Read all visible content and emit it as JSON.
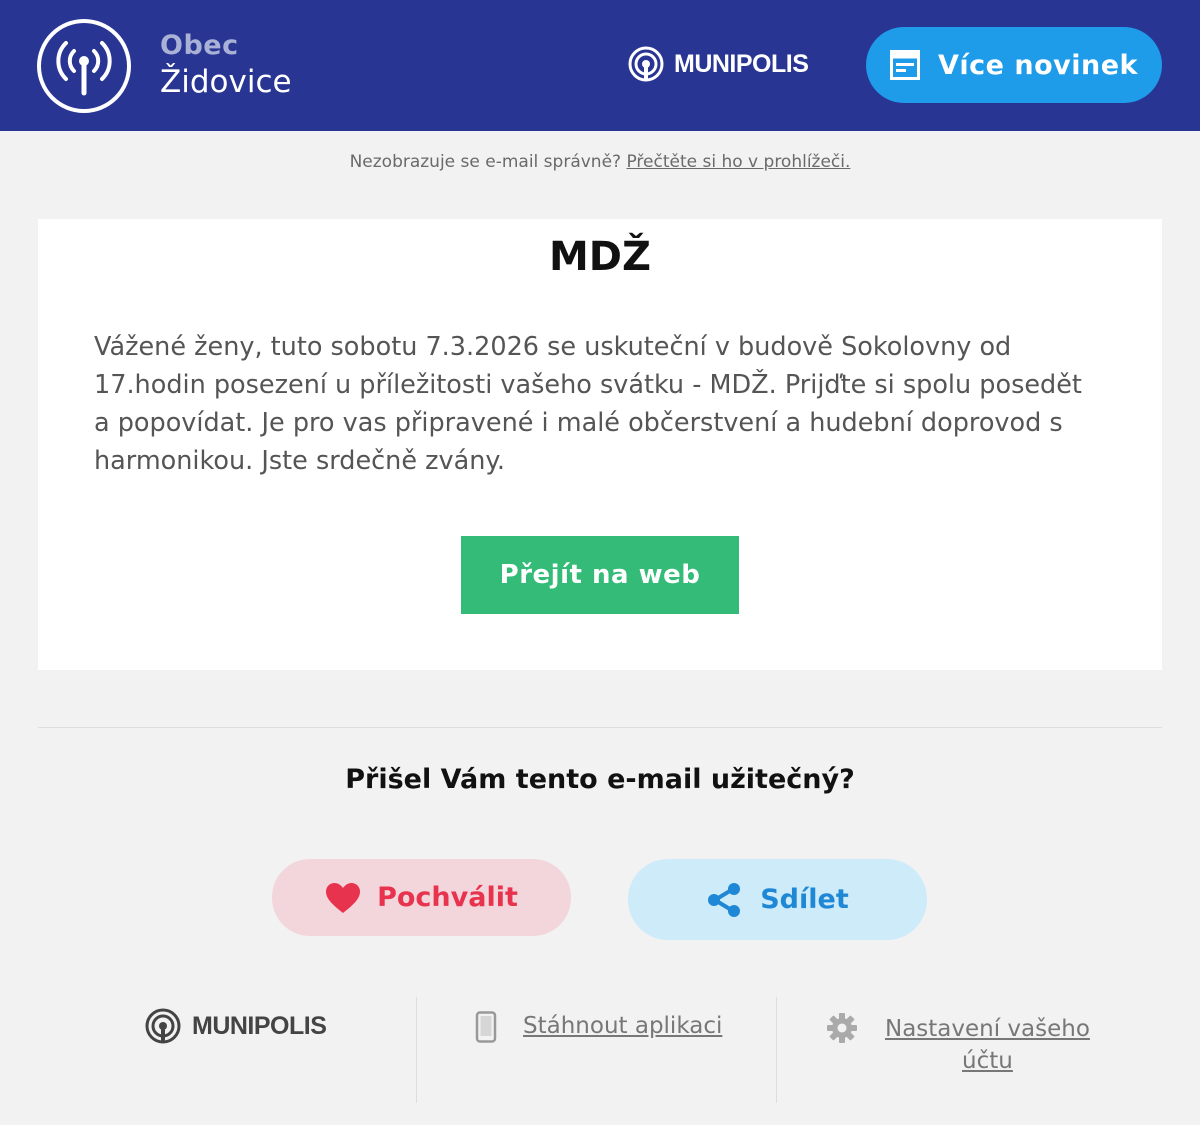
{
  "header": {
    "town_prefix": "Obec",
    "town_name": "Židovice",
    "brand_name": "MUNIPOLIS",
    "more_news_label": "Více novinek"
  },
  "preheader": {
    "text": "Nezobrazuje se e-mail správně?",
    "link_label": "Přečtěte si ho v prohlížeči."
  },
  "article": {
    "title": "MDŽ",
    "body": "Vážené ženy, tuto sobotu 7.3.2026 se uskuteční v budově Sokolovny od 17.hodin posezení u příležitosti vašeho svátku - MDŽ. Prijďte si spolu posedět a popovídat. Je pro vas připravené i malé občerstvení a hudební doprovod s harmonikou. Jste srdečně zvány.",
    "web_button_label": "Přejít na web"
  },
  "feedback": {
    "question": "Přišel Vám tento e-mail užitečný?",
    "praise_label": "Pochválit",
    "share_label": "Sdílet"
  },
  "footer": {
    "brand_name": "MUNIPOLIS",
    "download_label": "Stáhnout aplikaci",
    "settings_label_line1": "Nastavení vašeho",
    "settings_label_line2": "účtu"
  },
  "colors": {
    "header_bg": "#283593",
    "accent_blue": "#1e9be9",
    "web_button_green": "#33bb77",
    "praise_red": "#e8334f",
    "share_blue": "#1e88d6"
  },
  "icons": {
    "logo": "broadcast-tower-icon",
    "news": "newspaper-icon",
    "praise": "heart-icon",
    "share": "share-icon",
    "download": "phone-icon",
    "settings": "gear-icon"
  }
}
